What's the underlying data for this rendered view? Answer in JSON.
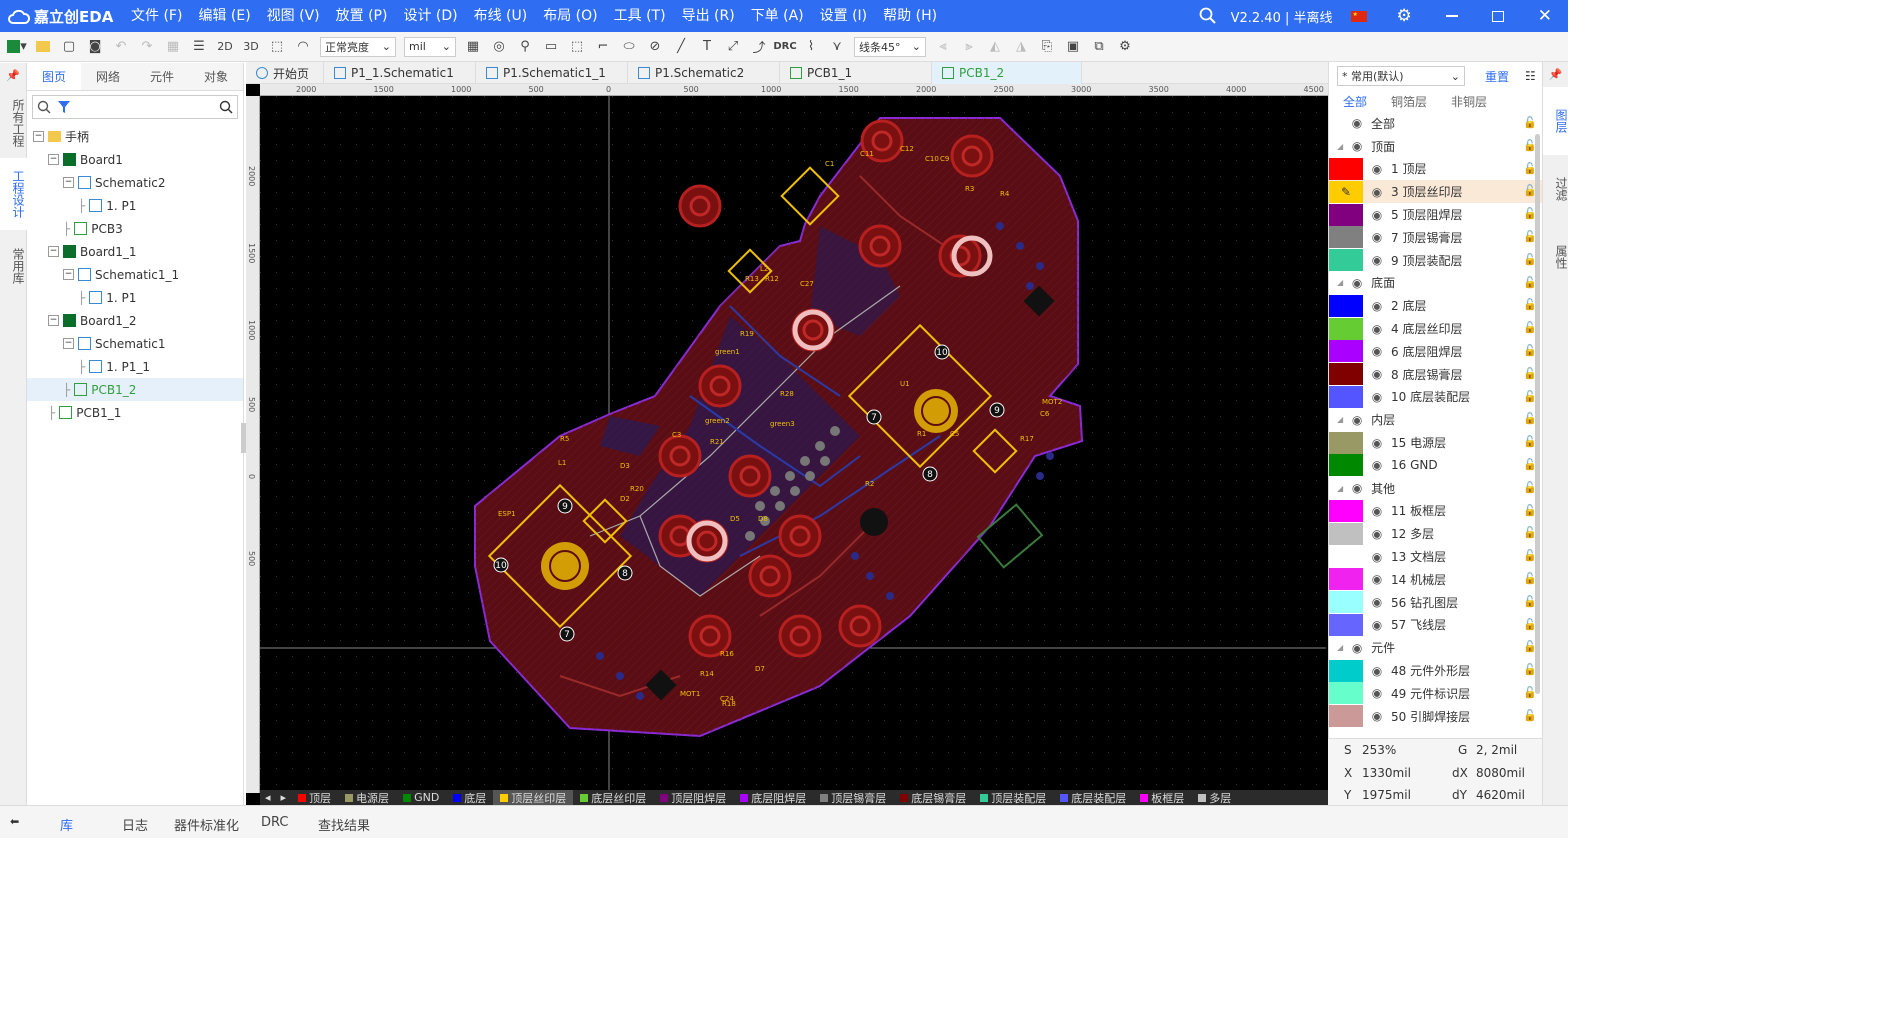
{
  "app": {
    "logo_text": "嘉立创EDA",
    "menu": [
      "文件 (F)",
      "编辑 (E)",
      "视图 (V)",
      "放置 (P)",
      "设计 (D)",
      "布线 (U)",
      "布局 (O)",
      "工具 (T)",
      "导出 (R)",
      "下单 (A)",
      "设置 (I)",
      "帮助 (H)"
    ],
    "version": "V2.2.40 | 半离线",
    "accent": "#2f6df2"
  },
  "toolbar": {
    "view_2d": "2D",
    "view_3d": "3D",
    "brightness": "正常亮度",
    "unit": "mil",
    "drc": "DRC",
    "routing_angle": "线条45°"
  },
  "left_strip": [
    "所有工程",
    "工程设计",
    "常用库"
  ],
  "left_panel": {
    "tabs": [
      "图页",
      "网络",
      "元件",
      "对象"
    ],
    "active_tab": "图页",
    "search_placeholder": "",
    "tree": [
      {
        "label": "手柄",
        "depth": 0,
        "icon": "folder",
        "expander": "−"
      },
      {
        "label": "Board1",
        "depth": 1,
        "icon": "board",
        "expander": "−"
      },
      {
        "label": "Schematic2",
        "depth": 2,
        "icon": "schematic",
        "expander": "−"
      },
      {
        "label": "1. P1",
        "depth": 3,
        "icon": "page"
      },
      {
        "label": "PCB3",
        "depth": 2,
        "icon": "pcb"
      },
      {
        "label": "Board1_1",
        "depth": 1,
        "icon": "board",
        "expander": "−"
      },
      {
        "label": "Schematic1_1",
        "depth": 2,
        "icon": "schematic",
        "expander": "−"
      },
      {
        "label": "1. P1",
        "depth": 3,
        "icon": "page"
      },
      {
        "label": "Board1_2",
        "depth": 1,
        "icon": "board",
        "expander": "−"
      },
      {
        "label": "Schematic1",
        "depth": 2,
        "icon": "schematic",
        "expander": "−"
      },
      {
        "label": "1. P1_1",
        "depth": 3,
        "icon": "page"
      },
      {
        "label": "PCB1_2",
        "depth": 2,
        "icon": "pcb",
        "selected": true
      },
      {
        "label": "PCB1_1",
        "depth": 1,
        "icon": "pcb"
      }
    ]
  },
  "doc_tabs": [
    {
      "label": "开始页",
      "icon": "cloud"
    },
    {
      "label": "P1_1.Schematic1",
      "icon": "page"
    },
    {
      "label": "P1.Schematic1_1",
      "icon": "page"
    },
    {
      "label": "P1.Schematic2",
      "icon": "page"
    },
    {
      "label": "PCB1_1",
      "icon": "pcb"
    },
    {
      "label": "PCB1_2",
      "icon": "pcb",
      "active": true
    }
  ],
  "ruler": {
    "h_ticks": [
      "2000",
      "1500",
      "1000",
      "500",
      "0",
      "500",
      "1000",
      "1500",
      "2000",
      "2500",
      "3000",
      "3500",
      "4000",
      "4500"
    ],
    "v_ticks": [
      "2000",
      "1500",
      "1000",
      "500",
      "0",
      "500"
    ]
  },
  "layer_bar": [
    {
      "name": "顶层",
      "color": "#ff0000"
    },
    {
      "name": "电源层",
      "color": "#999966"
    },
    {
      "name": "GND",
      "color": "#008800"
    },
    {
      "name": "底层",
      "color": "#0000ff"
    },
    {
      "name": "顶层丝印层",
      "color": "#ffcc00",
      "active": true
    },
    {
      "name": "底层丝印层",
      "color": "#66cc33"
    },
    {
      "name": "顶层阻焊层",
      "color": "#800080"
    },
    {
      "name": "底层阻焊层",
      "color": "#aa00ff"
    },
    {
      "name": "顶层锡膏层",
      "color": "#808080"
    },
    {
      "name": "底层锡膏层",
      "color": "#800000"
    },
    {
      "name": "顶层装配层",
      "color": "#33cc99"
    },
    {
      "name": "底层装配层",
      "color": "#5555ff"
    },
    {
      "name": "板框层",
      "color": "#ff00ff"
    },
    {
      "name": "多层",
      "color": "#c0c0c0"
    }
  ],
  "right_panel": {
    "preset": "* 常用(默认)",
    "reset_label": "重置",
    "tabs": [
      "全部",
      "铜箔层",
      "非铜层"
    ],
    "layers": [
      {
        "label": "全部",
        "group": true
      },
      {
        "label": "顶面",
        "group": true,
        "collapsible": true
      },
      {
        "label": "1 顶层",
        "color": "#ff0000"
      },
      {
        "label": "3 顶层丝印层",
        "color": "#ffcc00",
        "highlight": true
      },
      {
        "label": "5 顶层阻焊层",
        "color": "#800080"
      },
      {
        "label": "7 顶层锡膏层",
        "color": "#808080"
      },
      {
        "label": "9 顶层装配层",
        "color": "#33cc99"
      },
      {
        "label": "底面",
        "group": true,
        "collapsible": true
      },
      {
        "label": "2 底层",
        "color": "#0000ff"
      },
      {
        "label": "4 底层丝印层",
        "color": "#66cc33"
      },
      {
        "label": "6 底层阻焊层",
        "color": "#aa00ff"
      },
      {
        "label": "8 底层锡膏层",
        "color": "#800000"
      },
      {
        "label": "10 底层装配层",
        "color": "#5555ff"
      },
      {
        "label": "内层",
        "group": true,
        "collapsible": true
      },
      {
        "label": "15 电源层",
        "color": "#999966"
      },
      {
        "label": "16 GND",
        "color": "#008800"
      },
      {
        "label": "其他",
        "group": true,
        "collapsible": true
      },
      {
        "label": "11 板框层",
        "color": "#ff00ff"
      },
      {
        "label": "12 多层",
        "color": "#c0c0c0"
      },
      {
        "label": "13 文档层",
        "color": "#ffffff"
      },
      {
        "label": "14 机械层",
        "color": "#f022f0"
      },
      {
        "label": "56 钻孔图层",
        "color": "#99ffff"
      },
      {
        "label": "57 飞线层",
        "color": "#6666ff"
      },
      {
        "label": "元件",
        "group": true,
        "collapsible": true
      },
      {
        "label": "48 元件外形层",
        "color": "#00cccc"
      },
      {
        "label": "49 元件标识层",
        "color": "#66ffcc"
      },
      {
        "label": "50 引脚焊接层",
        "color": "#cc9999"
      }
    ]
  },
  "right_strip": [
    "图层",
    "过滤",
    "属性"
  ],
  "status": {
    "s": "S",
    "s_val": "253%",
    "g": "G",
    "g_val": "2, 2mil",
    "x": "X",
    "x_val": "1330mil",
    "dx": "dX",
    "dx_val": "8080mil",
    "y": "Y",
    "y_val": "1975mil",
    "dy": "dY",
    "dy_val": "4620mil"
  },
  "bottom_tabs": [
    "库",
    "日志",
    "器件标准化",
    "DRC",
    "查找结果"
  ],
  "pcb_labels": [
    "C27",
    "R19",
    "C3",
    "R21",
    "D5",
    "D8",
    "L1",
    "R20",
    "C6",
    "R1",
    "D2",
    "L2",
    "C9",
    "C10",
    "R14",
    "C24",
    "C11",
    "D7",
    "R13",
    "C12",
    "R28",
    "MOT2",
    "MOT1",
    "R18",
    "C5",
    "R17",
    "R2",
    "R12",
    "D3",
    "R16",
    "green1",
    "green2",
    "green3",
    "ESP1",
    "U1",
    "C1",
    "R3",
    "R4",
    "R5"
  ],
  "pcb_pin_numbers": [
    "10",
    "7",
    "8",
    "9",
    "10",
    "7",
    "8",
    "9"
  ]
}
